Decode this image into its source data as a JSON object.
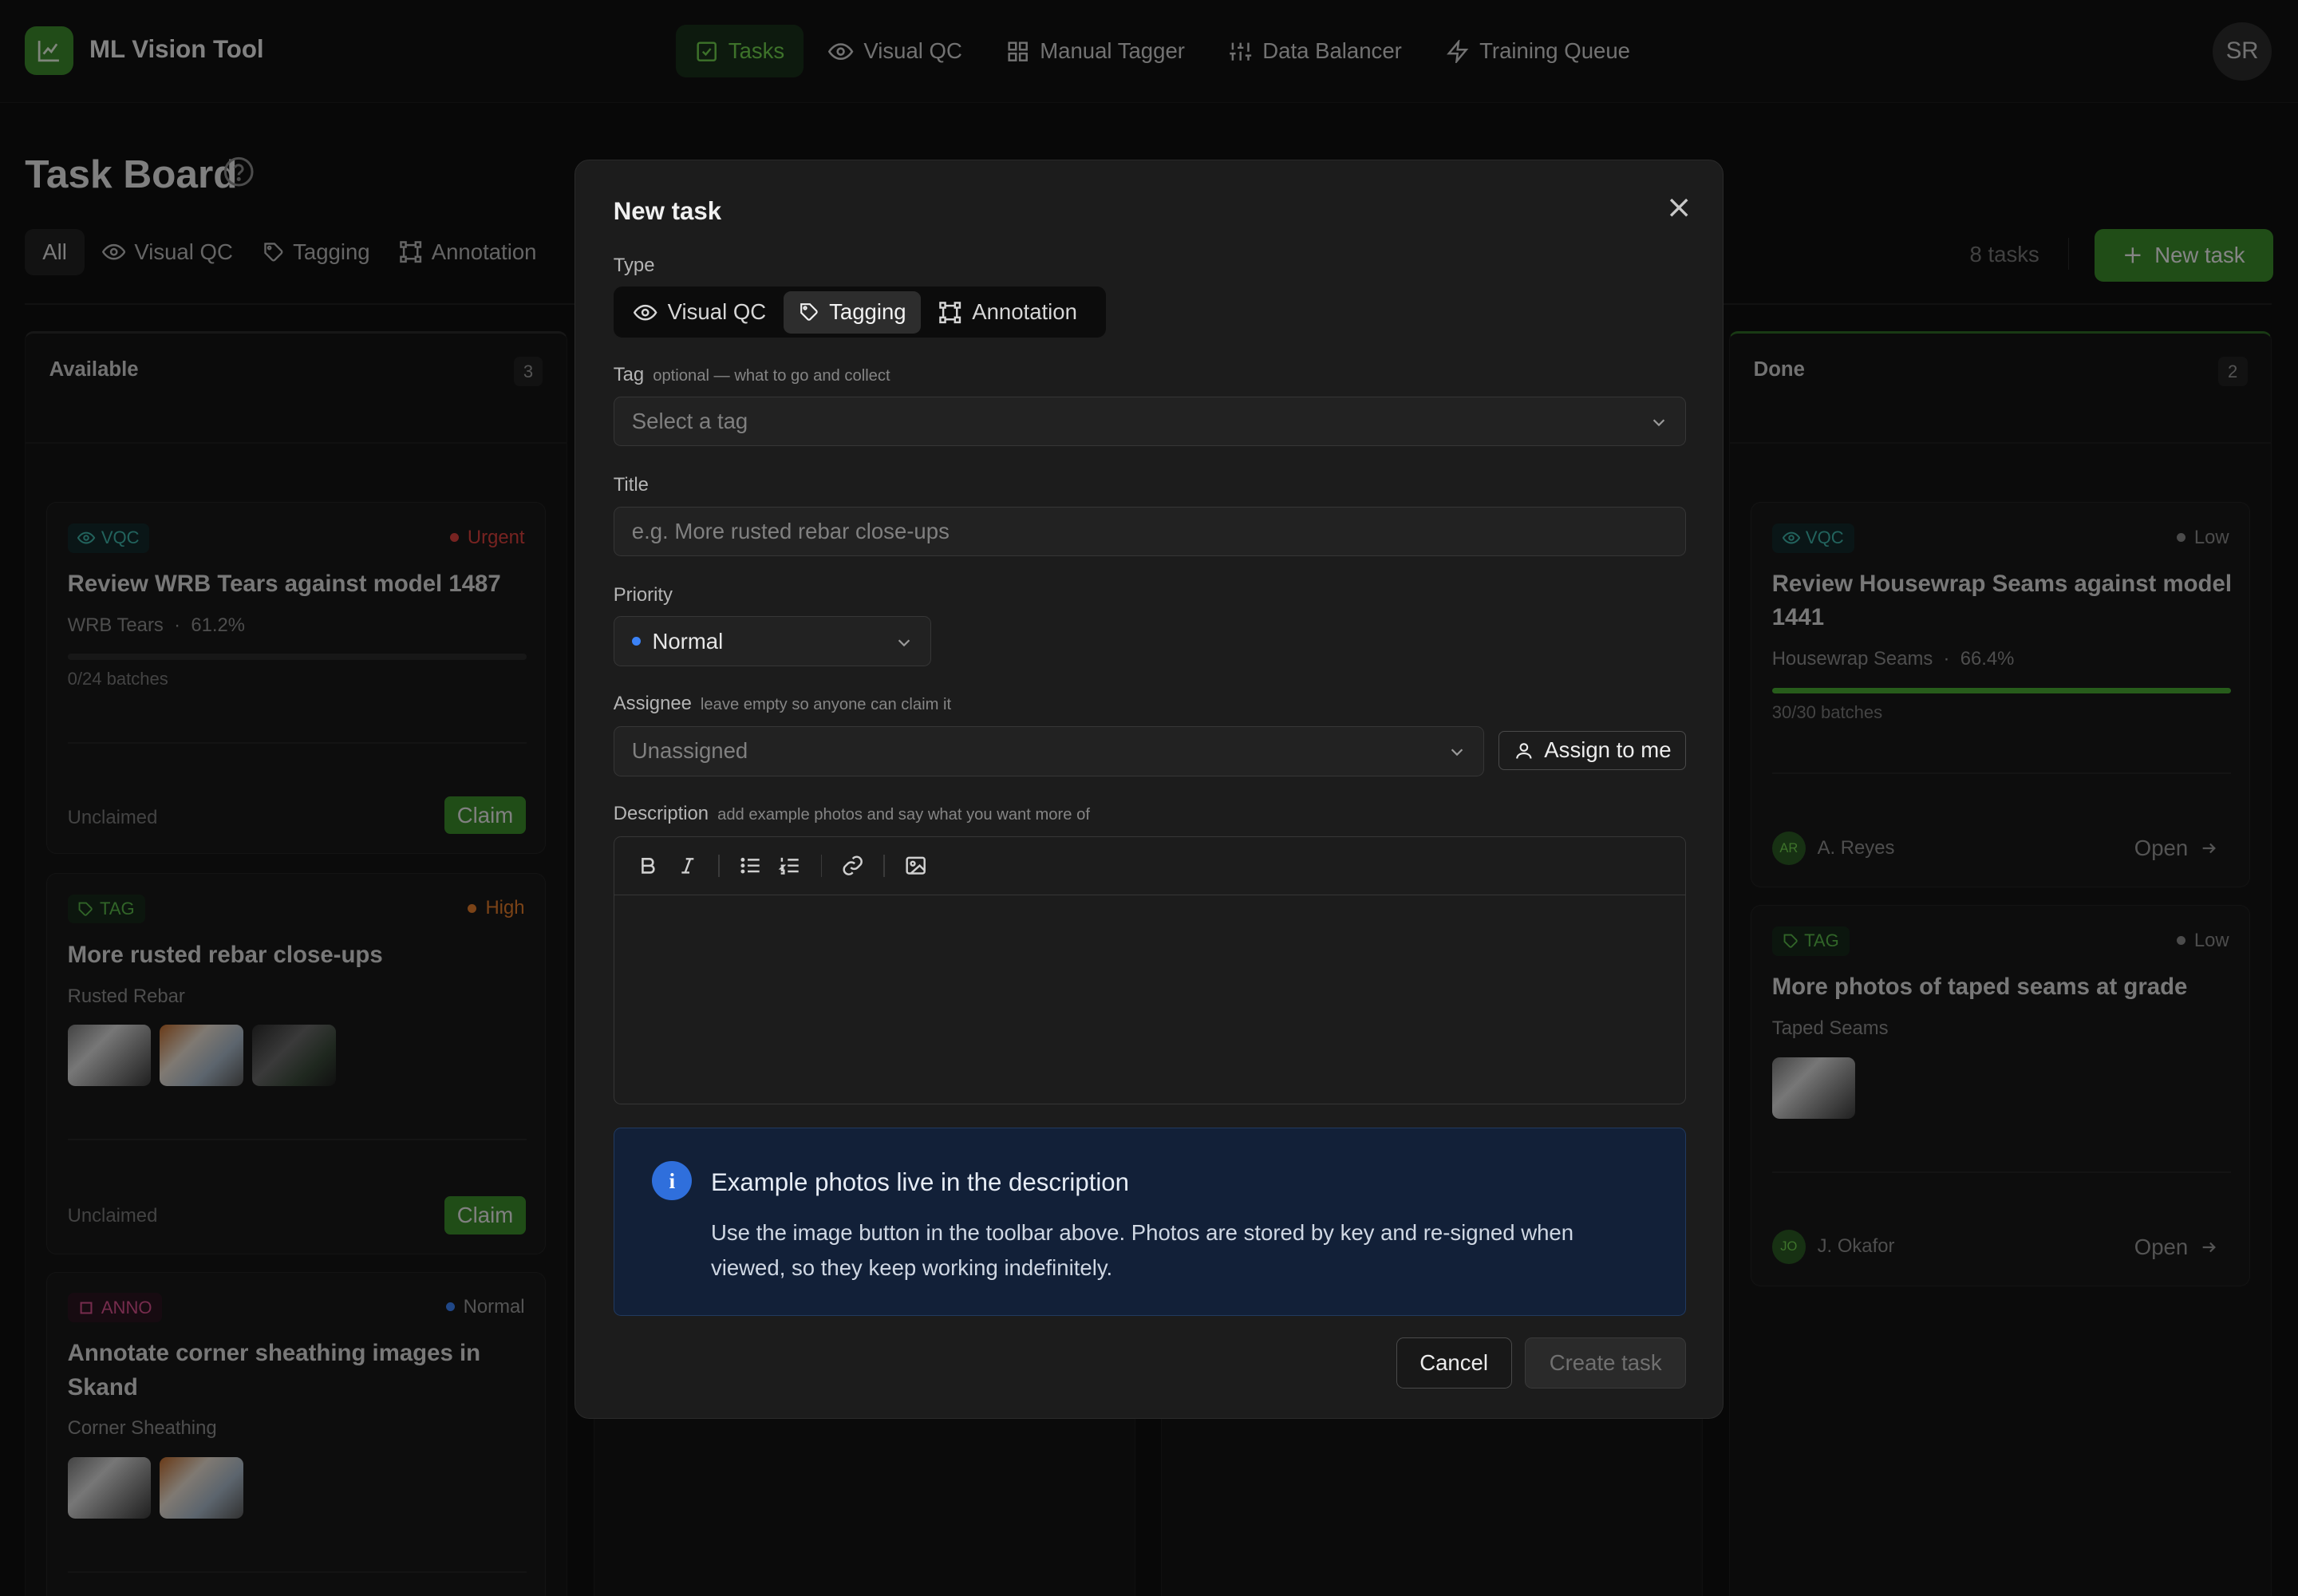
{
  "app": {
    "title": "ML Vision Tool",
    "user_initials": "SR",
    "accent": "#3b8c2a"
  },
  "nav": [
    {
      "label": "Tasks",
      "icon": "check-square-icon",
      "active": true
    },
    {
      "label": "Visual QC",
      "icon": "eye-icon"
    },
    {
      "label": "Manual Tagger",
      "icon": "grid-icon"
    },
    {
      "label": "Data Balancer",
      "icon": "sliders-icon"
    },
    {
      "label": "Training Queue",
      "icon": "lightning-icon"
    }
  ],
  "board": {
    "title": "Task Board",
    "filters": [
      "All",
      "Visual QC",
      "Tagging",
      "Annotation"
    ],
    "task_count": "8 tasks",
    "new_task_label": "New task"
  },
  "columns": {
    "available": {
      "title": "Available",
      "count": "3",
      "cards": [
        {
          "badge": "VQC",
          "priority": "Urgent",
          "priority_color": "#d9413d",
          "title": "Review WRB Tears against model 1487",
          "subtitle": "WRB Tears",
          "metric": "61.2%",
          "progress": 0,
          "batches": "0/24 batches",
          "status": "Unclaimed",
          "action": "Claim"
        },
        {
          "badge": "TAG",
          "priority": "High",
          "priority_color": "#e07a2a",
          "title": "More rusted rebar close-ups",
          "subtitle": "Rusted Rebar",
          "status": "Unclaimed",
          "action": "Claim"
        },
        {
          "badge": "ANNO",
          "priority": "Normal",
          "priority_color": "#3b82f6",
          "title": "Annotate corner sheathing images in Skand",
          "subtitle": "Corner Sheathing"
        }
      ]
    },
    "done": {
      "title": "Done",
      "count": "2",
      "cards": [
        {
          "badge": "VQC",
          "priority": "Low",
          "priority_color": "#8a8a8a",
          "title": "Review Housewrap Seams against model 1441",
          "subtitle": "Housewrap Seams",
          "metric": "66.4%",
          "progress": 1,
          "batches": "30/30 batches",
          "assignee_initials": "AR",
          "assignee": "A. Reyes",
          "action": "Open"
        },
        {
          "badge": "TAG",
          "priority": "Low",
          "priority_color": "#8a8a8a",
          "title": "More photos of taped seams at grade",
          "subtitle": "Taped Seams",
          "assignee_initials": "JO",
          "assignee": "J. Okafor",
          "action": "Open"
        }
      ]
    }
  },
  "modal": {
    "title": "New task",
    "type_label": "Type",
    "types": [
      "Visual QC",
      "Tagging",
      "Annotation"
    ],
    "selected_type": "Tagging",
    "tag_label": "Tag",
    "tag_hint": "optional — what to go and collect",
    "tag_placeholder": "Select a tag",
    "title_label": "Title",
    "title_placeholder": "e.g. More rusted rebar close-ups",
    "priority_label": "Priority",
    "priority_value": "Normal",
    "assignee_label": "Assignee",
    "assignee_hint": "leave empty so anyone can claim it",
    "assignee_placeholder": "Unassigned",
    "assign_me_label": "Assign to me",
    "description_label": "Description",
    "description_hint": "add example photos and say what you want more of",
    "info_title": "Example photos live in the description",
    "info_text": "Use the image button in the toolbar above. Photos are stored by key and re-signed when viewed, so they keep working indefinitely.",
    "cancel_label": "Cancel",
    "create_label": "Create task"
  }
}
